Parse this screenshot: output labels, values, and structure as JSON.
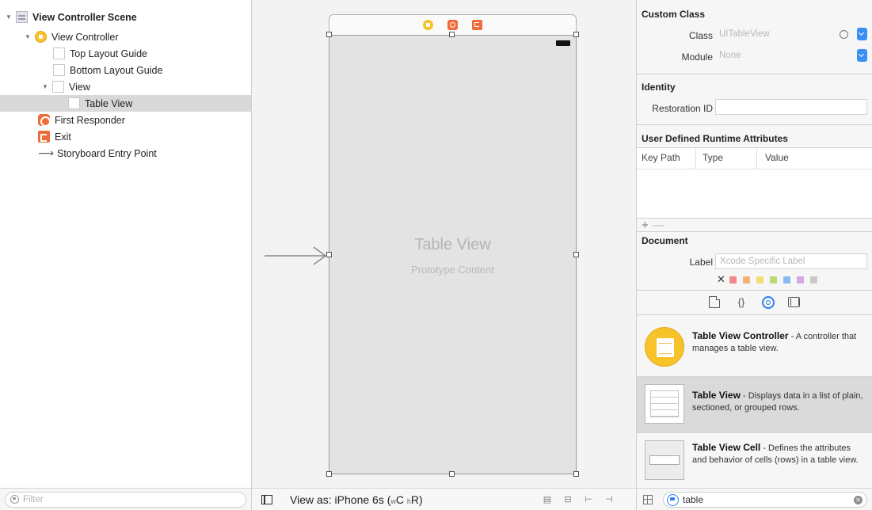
{
  "outline": {
    "items": [
      {
        "label": "View Controller Scene",
        "icon": "scene-icon"
      },
      {
        "label": "View Controller",
        "icon": "view-controller-icon"
      },
      {
        "label": "Top Layout Guide",
        "icon": "layout-guide-icon"
      },
      {
        "label": "Bottom Layout Guide",
        "icon": "layout-guide-icon"
      },
      {
        "label": "View",
        "icon": "view-icon"
      },
      {
        "label": "Table View",
        "icon": "table-view-icon",
        "selected": true
      },
      {
        "label": "First Responder",
        "icon": "first-responder-icon"
      },
      {
        "label": "Exit",
        "icon": "exit-icon"
      },
      {
        "label": "Storyboard Entry Point",
        "icon": "entry-arrow-icon"
      }
    ],
    "filter_placeholder": "Filter"
  },
  "canvas": {
    "table_view_title": "Table View",
    "table_view_subtitle": "Prototype Content",
    "view_as_prefix": "View as: iPhone 6s (",
    "view_as_w": "w",
    "view_as_c": "C ",
    "view_as_h": "h",
    "view_as_r": "R)"
  },
  "inspector": {
    "custom_class": {
      "heading": "Custom Class",
      "class_label": "Class",
      "class_placeholder": "UITableView",
      "module_label": "Module",
      "module_placeholder": "None"
    },
    "identity": {
      "heading": "Identity",
      "restoration_label": "Restoration ID",
      "restoration_value": ""
    },
    "runtime_attrs": {
      "heading": "User Defined Runtime Attributes",
      "columns": [
        "Key Path",
        "Type",
        "Value"
      ],
      "add": "+",
      "remove": "—"
    },
    "document": {
      "heading": "Document",
      "label_label": "Label",
      "label_placeholder": "Xcode Specific Label",
      "clear_glyph": "✕",
      "label_colors": [
        "#f08a8a",
        "#f3b275",
        "#f3dc74",
        "#b9dc7a",
        "#8ab8f3",
        "#d7a6e5",
        "#c9c9c9"
      ]
    },
    "library": {
      "items": [
        {
          "title": "Table View Controller",
          "desc": " - A controller that manages a table view."
        },
        {
          "title": "Table View",
          "desc": " - Displays data in a list of plain, sectioned, or grouped rows.",
          "selected": true
        },
        {
          "title": "Table View Cell",
          "desc": " - Defines the attributes and behavior of cells (rows) in a table view."
        }
      ],
      "search_value": "table"
    }
  },
  "colors": {
    "accent_blue": "#2f7ef2",
    "vc_yellow": "#f7c22a",
    "responder_orange": "#ef6b3a",
    "selection_gray": "#d9d9d9"
  }
}
